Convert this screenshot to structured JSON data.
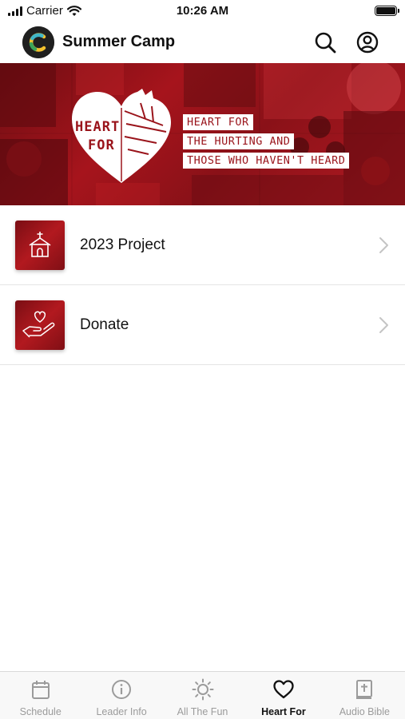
{
  "status_bar": {
    "carrier": "Carrier",
    "time": "10:26 AM"
  },
  "header": {
    "title": "Summer Camp",
    "logo_icon": "app-logo-c",
    "search_icon": "search-icon",
    "account_icon": "account-icon"
  },
  "banner": {
    "heart_word_1": "HEART",
    "heart_word_2": "FOR",
    "lines": [
      "HEART FOR",
      "THE HURTING AND",
      "THOSE WHO HAVEN'T HEARD"
    ]
  },
  "list": {
    "items": [
      {
        "label": "2023 Project",
        "icon": "church-icon"
      },
      {
        "label": "Donate",
        "icon": "giving-hand-icon"
      }
    ]
  },
  "tab_bar": {
    "active": "Heart For",
    "tabs": [
      {
        "label": "Schedule",
        "icon": "calendar-icon"
      },
      {
        "label": "Leader Info",
        "icon": "info-icon"
      },
      {
        "label": "All The Fun",
        "icon": "sun-icon"
      },
      {
        "label": "Heart For",
        "icon": "heart-icon"
      },
      {
        "label": "Audio Bible",
        "icon": "bible-icon"
      }
    ]
  },
  "colors": {
    "brand_red": "#a6141c",
    "active_tab": "#111111",
    "inactive_tab": "#9b9b9b"
  }
}
